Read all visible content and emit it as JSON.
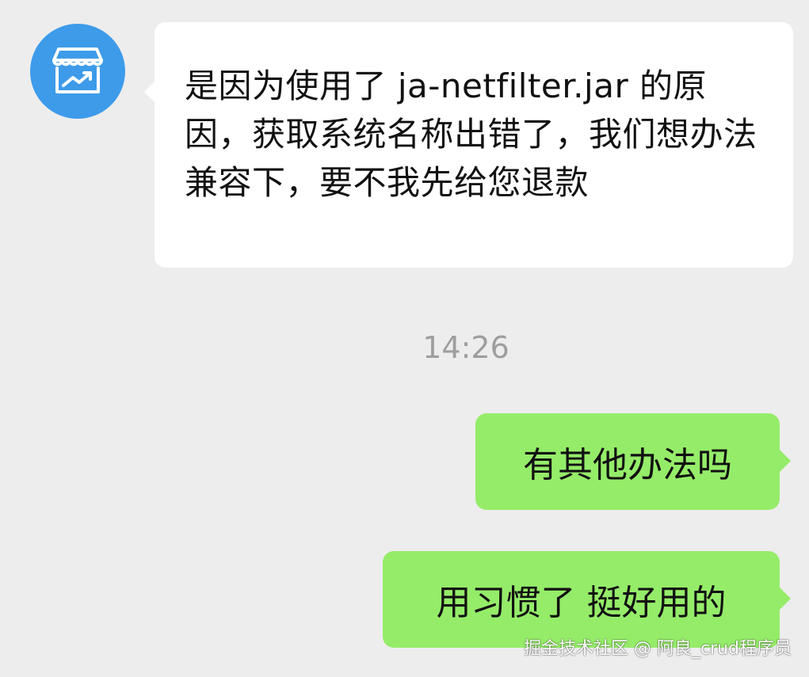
{
  "messages": {
    "incoming_text": "是因为使用了 ja-netfilter.jar 的原因，获取系统名称出错了，我们想办法兼容下，要不我先给您退款",
    "timestamp": "14:26",
    "outgoing": [
      {
        "text": "有其他办法吗"
      },
      {
        "text": "用习惯了 挺好用的"
      }
    ]
  },
  "avatar": {
    "icon": "storefront-chart-icon",
    "background_color": "#3D9BEA"
  },
  "colors": {
    "chat_background": "#EDEDED",
    "incoming_bubble": "#FFFFFF",
    "outgoing_bubble": "#95EC69",
    "timestamp_text": "#9E9E9E"
  },
  "watermark": {
    "text": "掘金技术社区 @ 阿良_crud程序员"
  }
}
